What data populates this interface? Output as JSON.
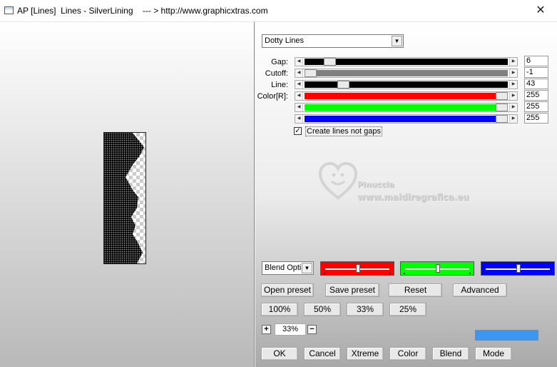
{
  "window": {
    "title": "AP [Lines]  Lines - SilverLining    --- > http://www.graphicxtras.com",
    "close_glyph": "✕"
  },
  "effect_select": {
    "value": "Dotty Lines"
  },
  "sliders": [
    {
      "label": "Gap:",
      "value": "6",
      "fill_color": "#000000",
      "position": 0.1
    },
    {
      "label": "Cutoff:",
      "value": "-1",
      "fill_color": "#808080",
      "position": 0.0
    },
    {
      "label": "Line:",
      "value": "43",
      "fill_color": "#000000",
      "position": 0.17
    },
    {
      "label": "Color[R]:",
      "value": "255",
      "fill_color": "#ff0000",
      "position": 1.0
    },
    {
      "label": "",
      "value": "255",
      "fill_color": "#00ff00",
      "position": 1.0
    },
    {
      "label": "",
      "value": "255",
      "fill_color": "#0000ff",
      "position": 1.0
    }
  ],
  "create_lines_checkbox": {
    "label": "Create lines not gaps",
    "checked": true,
    "glyph": "✓"
  },
  "watermark": {
    "line1": "Pinuccia",
    "line2": "www.maidiregrafica.eu"
  },
  "blend_select": {
    "value": "Blend Opti"
  },
  "blend_swatches": [
    {
      "color": "#ff0000",
      "position": 0.5
    },
    {
      "color": "#00ff00",
      "position": 0.5
    },
    {
      "color": "#0000ff",
      "position": 0.5
    }
  ],
  "preset_buttons": {
    "open_preset": "Open preset",
    "save_preset": "Save preset",
    "reset": "Reset",
    "advanced": "Advanced"
  },
  "zoom_buttons": {
    "z100": "100%",
    "z50": "50%",
    "z33": "33%",
    "z25": "25%"
  },
  "zoom": {
    "plus": "+",
    "value": "33%",
    "minus": "−"
  },
  "color_bar": {
    "color": "#3c97f2"
  },
  "action_buttons": {
    "ok": "OK",
    "cancel": "Cancel",
    "xtreme": "Xtreme",
    "color": "Color",
    "blend": "Blend",
    "mode": "Mode"
  }
}
